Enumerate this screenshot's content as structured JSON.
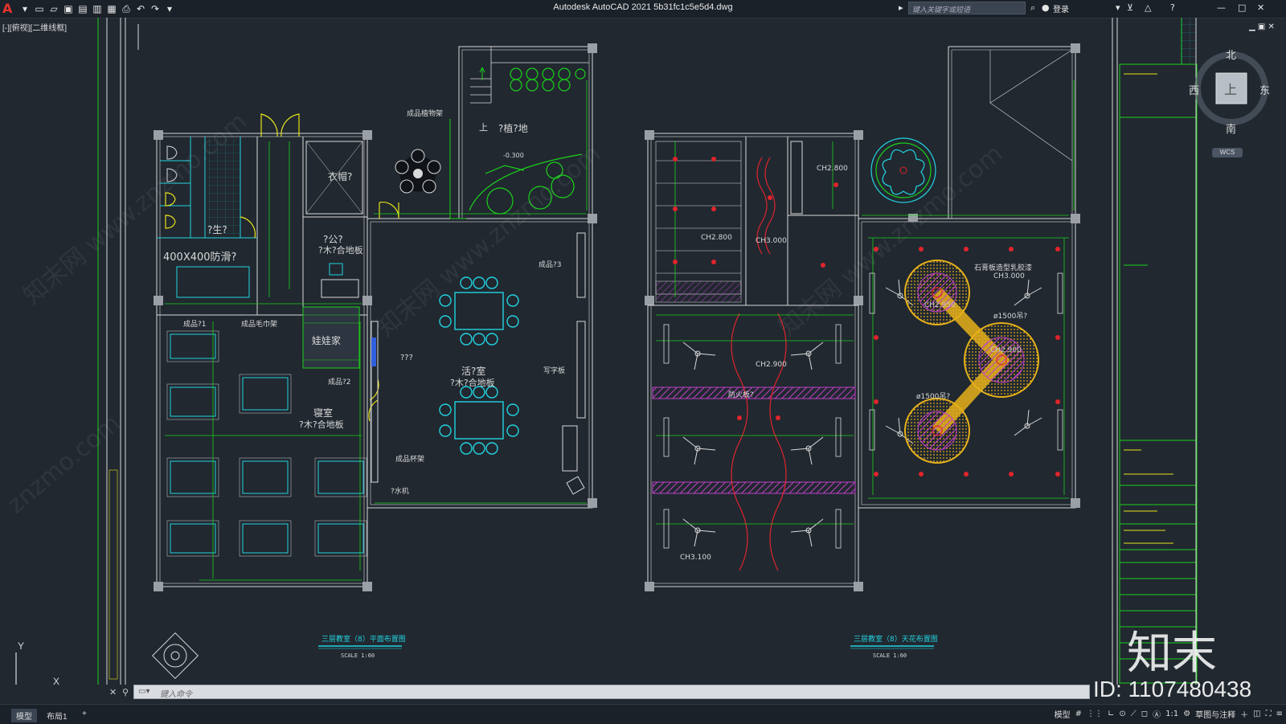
{
  "app": {
    "logo_glyph": "A",
    "title": "Autodesk AutoCAD 2021    5b31fc1c5e5d4.dwg",
    "search_placeholder": "键入关键字或短语",
    "login_label": "登录"
  },
  "viewport": {
    "label": "[-][俯视][二维线框]"
  },
  "viewcube": {
    "north": "北",
    "south": "南",
    "east": "东",
    "west": "西",
    "top_face": "上",
    "wcs": "WCS"
  },
  "ucs": {
    "y": "Y",
    "x": "X"
  },
  "plans": {
    "floor_plan": {
      "title": "三层教室（8）平面布置图",
      "scale": "SCALE  1:60",
      "labels": {
        "toilet": "?生?",
        "anti_slip": "400X400防滑?",
        "cloakroom": "衣帽?",
        "office": "?公?",
        "office_floor": "?木?合地板",
        "doll_house": "娃娃家",
        "activity_room": "活?室",
        "activity_floor": "?木?合地板",
        "bedroom": "寝室",
        "bedroom_floor": "?木?合地板",
        "plant_corner": "?植?地",
        "level": "-0.300",
        "finished_cabinet_1": "成品?1",
        "towel_rack": "成品毛巾架",
        "finished_cabinet_2": "成品?2",
        "finished_cabinet_3": "成品?3",
        "plant_rack": "成品植物架",
        "cup_rack": "成品杯架",
        "water_dispenser": "?水机",
        "writing_board": "写字板",
        "query": "???",
        "up": "上"
      }
    },
    "ceiling_plan": {
      "title": "三层教室（8）天花布置图",
      "scale": "SCALE  1:60",
      "labels": {
        "ch2800_a": "CH2.800",
        "ch2800_b": "CH2.800",
        "ch3000_a": "CH3.000",
        "ch3000_b": "CH3.000",
        "ch2900": "CH2.900",
        "ch3100": "CH3.100",
        "fan_ceiling": "石膏板造型乳胶漆",
        "dia1500_a": "ø1500吊?",
        "dia1500_b": "ø1500吊?",
        "ch2950": "CH2.950",
        "ch2900b": "CH2.900",
        "fire_board": "防火板?"
      }
    }
  },
  "command": {
    "placeholder": "键入命令"
  },
  "layout_tabs": [
    {
      "label": "模型",
      "active": true
    },
    {
      "label": "布局1",
      "active": false
    },
    {
      "label": "+",
      "active": false
    }
  ],
  "status": {
    "model": "模型",
    "scale": "1:1",
    "workspace": "草图与注释"
  },
  "watermark": {
    "id_text": "ID: 1107480438",
    "logo": "知末"
  },
  "colors": {
    "background": "#212830",
    "line_white": "#d9d9d9",
    "line_green": "#1bd11b",
    "line_cyan": "#22d3e0",
    "line_yellow": "#e6e21a",
    "line_red": "#e0242b",
    "hatch_magenta": "#c040c8"
  }
}
